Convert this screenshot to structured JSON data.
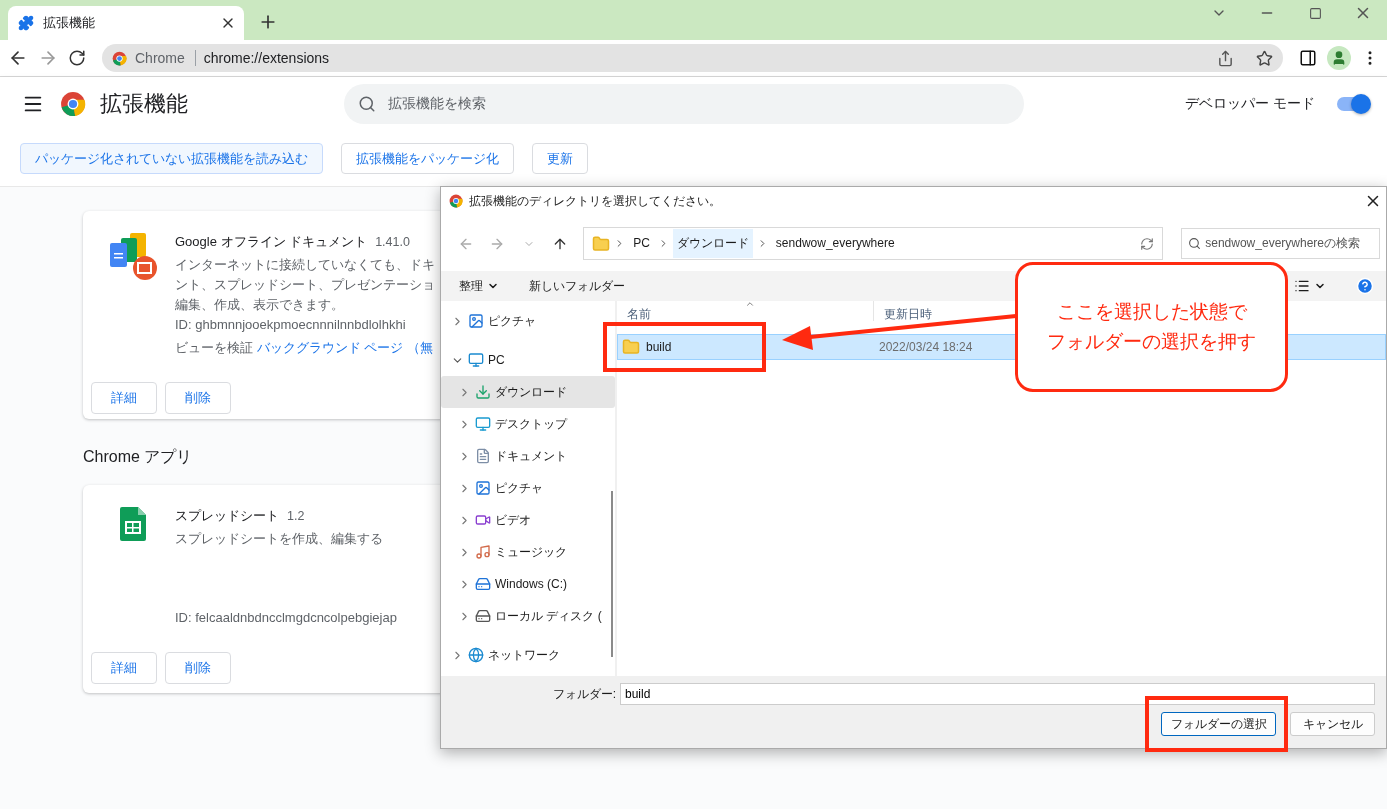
{
  "browser": {
    "tab": {
      "title": "拡張機能"
    },
    "omnibox": {
      "chip": "Chrome",
      "url": "chrome://extensions"
    }
  },
  "page": {
    "title": "拡張機能",
    "search": {
      "placeholder": "拡張機能を検索"
    },
    "developer_mode": {
      "label": "デベロッパー モード",
      "on": true
    },
    "actions": [
      {
        "label": "パッケージ化されていない拡張機能を読み込む",
        "highlighted": true
      },
      {
        "label": "拡張機能をパッケージ化",
        "highlighted": false
      },
      {
        "label": "更新",
        "highlighted": false
      }
    ],
    "extensions": [
      {
        "kind": "docs",
        "name": "Google オフライン ドキュメント",
        "version": "1.41.0",
        "description_lines": [
          "インターネットに接続していなくても、ドキ",
          "ント、スプレッドシート、プレゼンテーショ",
          "編集、作成、表示できます。"
        ],
        "id": "ID: ghbmnnjooekpmoecnnnilnnbdlolhkhi",
        "inspect_label": "ビューを検証",
        "inspect_link": "バックグラウンド ページ",
        "inspect_rest": "（無",
        "buttons": [
          "詳細",
          "削除"
        ]
      }
    ],
    "apps_heading": "Chrome アプリ",
    "apps": [
      {
        "kind": "sheets",
        "name": "スプレッドシート",
        "version": "1.2",
        "description_lines": [
          "スプレッドシートを作成、編集する"
        ],
        "id": "ID: felcaaldnbdncclmgdcncolpebgiejap",
        "buttons": [
          "詳細",
          "削除"
        ]
      }
    ]
  },
  "dialog": {
    "title": "拡張機能のディレクトリを選択してください。",
    "breadcrumb": [
      {
        "label": "PC",
        "selected": false
      },
      {
        "label": "ダウンロード",
        "selected": true
      },
      {
        "label": "sendwow_everywhere",
        "selected": false
      }
    ],
    "search": {
      "placeholder": "sendwow_everywhereの検索"
    },
    "commands": [
      {
        "label": "整理",
        "dropdown": true
      },
      {
        "label": "新しいフォルダー",
        "dropdown": false
      }
    ],
    "nav": [
      {
        "kind": "pictures",
        "label": "ピクチャ",
        "expanded": false,
        "selected": false
      },
      {
        "kind": "pc",
        "label": "PC",
        "expanded": true,
        "selected": false,
        "children": [
          {
            "kind": "downloads",
            "label": "ダウンロード",
            "expanded": false,
            "selected": true
          },
          {
            "kind": "desktop",
            "label": "デスクトップ",
            "expanded": false,
            "selected": false
          },
          {
            "kind": "documents",
            "label": "ドキュメント",
            "expanded": false,
            "selected": false
          },
          {
            "kind": "pictures",
            "label": "ピクチャ",
            "expanded": false,
            "selected": false
          },
          {
            "kind": "videos",
            "label": "ビデオ",
            "expanded": false,
            "selected": false
          },
          {
            "kind": "music",
            "label": "ミュージック",
            "expanded": false,
            "selected": false
          },
          {
            "kind": "windows-drive",
            "label": "Windows (C:)",
            "expanded": false,
            "selected": false
          },
          {
            "kind": "drive",
            "label": "ローカル ディスク (",
            "expanded": false,
            "selected": false
          }
        ]
      },
      {
        "kind": "network",
        "label": "ネットワーク",
        "expanded": false,
        "selected": false
      }
    ],
    "columns": [
      {
        "label": "名前",
        "sorted": true
      },
      {
        "label": "更新日時",
        "sorted": false
      }
    ],
    "files": [
      {
        "name": "build",
        "modified": "2022/03/24 18:24",
        "selected": true
      }
    ],
    "folder_field": {
      "label": "フォルダー:",
      "value": "build"
    },
    "buttons": [
      {
        "label": "フォルダーの選択",
        "default": true
      },
      {
        "label": "キャンセル",
        "default": false
      }
    ]
  },
  "annotation": {
    "callout_lines": [
      "ここを選択した状態で",
      "フォルダーの選択を押す"
    ]
  }
}
